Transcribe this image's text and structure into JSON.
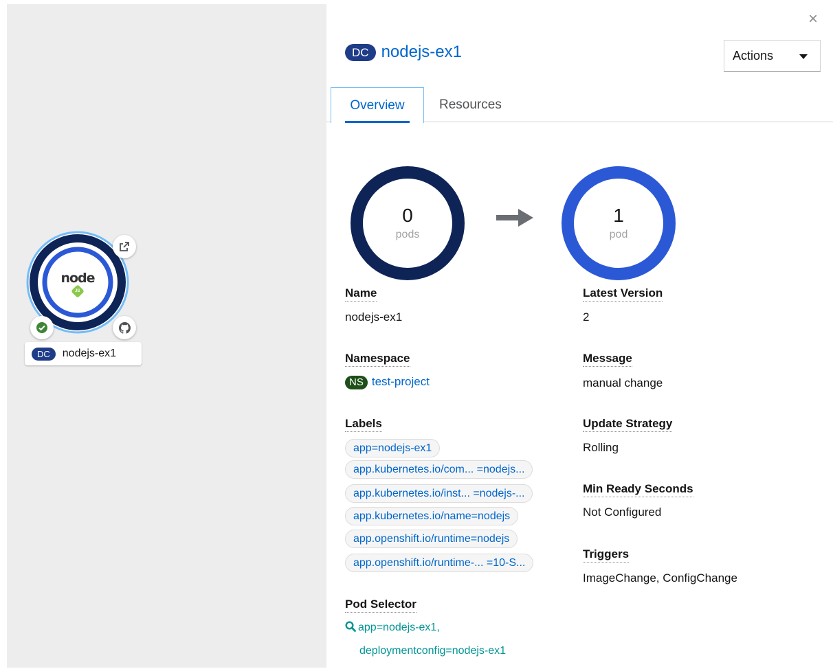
{
  "node": {
    "kind_badge": "DC",
    "name": "nodejs-ex1",
    "logo_text": "node",
    "logo_sub": "JS",
    "icons": [
      "external-link-icon",
      "check-circle-icon",
      "github-icon"
    ]
  },
  "panel": {
    "close_glyph": "×",
    "kind_badge": "DC",
    "title": "nodejs-ex1",
    "actions_label": "Actions",
    "tabs": [
      {
        "label": "Overview",
        "active": true
      },
      {
        "label": "Resources",
        "active": false
      }
    ],
    "pods": {
      "current": {
        "count": "0",
        "unit": "pods",
        "color": "#0f2456"
      },
      "target": {
        "count": "1",
        "unit": "pod",
        "color": "#2b59d6"
      }
    },
    "details": {
      "name_label": "Name",
      "name_value": "nodejs-ex1",
      "namespace_label": "Namespace",
      "namespace_badge": "NS",
      "namespace_value": "test-project",
      "labels_label": "Labels",
      "labels": [
        "app=nodejs-ex1",
        "app.kubernetes.io/com... =nodejs...",
        "app.kubernetes.io/inst... =nodejs-...",
        "app.kubernetes.io/name=nodejs",
        "app.openshift.io/runtime=nodejs",
        "app.openshift.io/runtime-... =10-S..."
      ],
      "pod_selector_label": "Pod Selector",
      "pod_selector_line1": "app=nodejs-ex1,",
      "pod_selector_line2": "deploymentconfig=nodejs-ex1",
      "latest_version_label": "Latest Version",
      "latest_version_value": "2",
      "message_label": "Message",
      "message_value": "manual change",
      "update_strategy_label": "Update Strategy",
      "update_strategy_value": "Rolling",
      "min_ready_label": "Min Ready Seconds",
      "min_ready_value": "Not Configured",
      "triggers_label": "Triggers",
      "triggers_value": "ImageChange, ConfigChange"
    }
  },
  "colors": {
    "link": "#0066cc",
    "dc_badge": "#1f3c88",
    "ns_badge": "#1e4f18",
    "status_ok": "#3e8635",
    "selector": "#009596"
  }
}
